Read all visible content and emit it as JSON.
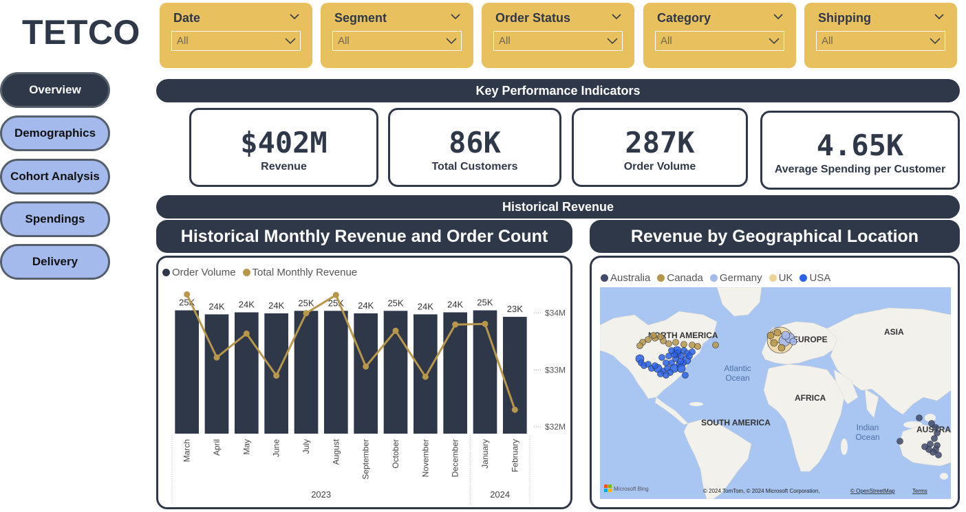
{
  "brand": {
    "logo": "TETCO"
  },
  "nav": [
    {
      "label": "Overview",
      "active": true
    },
    {
      "label": "Demographics",
      "active": false
    },
    {
      "label": "Cohort Analysis",
      "active": false
    },
    {
      "label": "Spendings",
      "active": false
    },
    {
      "label": "Delivery",
      "active": false
    }
  ],
  "filters": [
    {
      "title": "Date",
      "value": "All"
    },
    {
      "title": "Segment",
      "value": "All"
    },
    {
      "title": "Order Status",
      "value": "All"
    },
    {
      "title": "Category",
      "value": "All"
    },
    {
      "title": "Shipping",
      "value": "All"
    }
  ],
  "sections": {
    "kpi_header": "Key Performance Indicators",
    "historical_header": "Historical Revenue",
    "chart_title": "Historical Monthly Revenue and Order Count",
    "map_title": "Revenue by Geographical Location"
  },
  "kpis": [
    {
      "value": "$402M",
      "label": "Revenue"
    },
    {
      "value": "86K",
      "label": "Total Customers"
    },
    {
      "value": "287K",
      "label": "Order Volume"
    },
    {
      "value": "4.65K",
      "label": "Average Spending per Customer"
    }
  ],
  "colors": {
    "navy": "#2f3849",
    "gold": "#b8964a",
    "filter_bg": "#e9c05e",
    "nav_bg": "#a4b9ec"
  },
  "chart_data": {
    "type": "bar",
    "legend": [
      "Order Volume",
      "Total Monthly Revenue"
    ],
    "categories": [
      "March",
      "April",
      "May",
      "June",
      "July",
      "August",
      "September",
      "October",
      "November",
      "December",
      "January",
      "February"
    ],
    "year_groups": [
      {
        "label": "2023",
        "count": 10
      },
      {
        "label": "2024",
        "count": 2
      }
    ],
    "series": [
      {
        "name": "Order Volume",
        "type": "bar",
        "values": [
          24600,
          23800,
          24200,
          24000,
          24500,
          24500,
          24000,
          24500,
          23800,
          24200,
          24600,
          23300
        ],
        "labels": [
          "25K",
          "24K",
          "24K",
          "24K",
          "25K",
          "25K",
          "24K",
          "25K",
          "24K",
          "24K",
          "25K",
          "23K"
        ]
      },
      {
        "name": "Total Monthly Revenue",
        "type": "line",
        "values": [
          34.33,
          33.22,
          33.64,
          32.9,
          34.0,
          34.32,
          33.06,
          33.69,
          32.88,
          33.8,
          33.81,
          32.3
        ]
      }
    ],
    "right_axis": {
      "ticks": [
        32,
        33,
        34
      ],
      "tick_labels": [
        "$32M",
        "$33M",
        "$34M"
      ],
      "range": [
        32,
        34.25
      ]
    },
    "left_axis_range": [
      0,
      25500
    ],
    "grid": false
  },
  "map": {
    "legend": [
      {
        "name": "Australia",
        "color": "#3f4a6b"
      },
      {
        "name": "Canada",
        "color": "#b8964a"
      },
      {
        "name": "Germany",
        "color": "#a4b9ec"
      },
      {
        "name": "UK",
        "color": "#eed396"
      },
      {
        "name": "USA",
        "color": "#2962e8"
      }
    ],
    "labels": {
      "north_america": "NORTH AMERICA",
      "south_america": "SOUTH AMERICA",
      "europe": "EUROPE",
      "asia": "ASIA",
      "africa": "AFRICA",
      "australia": "AUSTRA",
      "atlantic": "Atlantic Ocean",
      "indian": "Indian Ocean"
    },
    "attribution": "© 2024 TomTom, © 2024 Microsoft Corporation,",
    "osm_link": "© OpenStreetMap",
    "terms_link": "Terms",
    "bing_label": "Microsoft Bing"
  }
}
